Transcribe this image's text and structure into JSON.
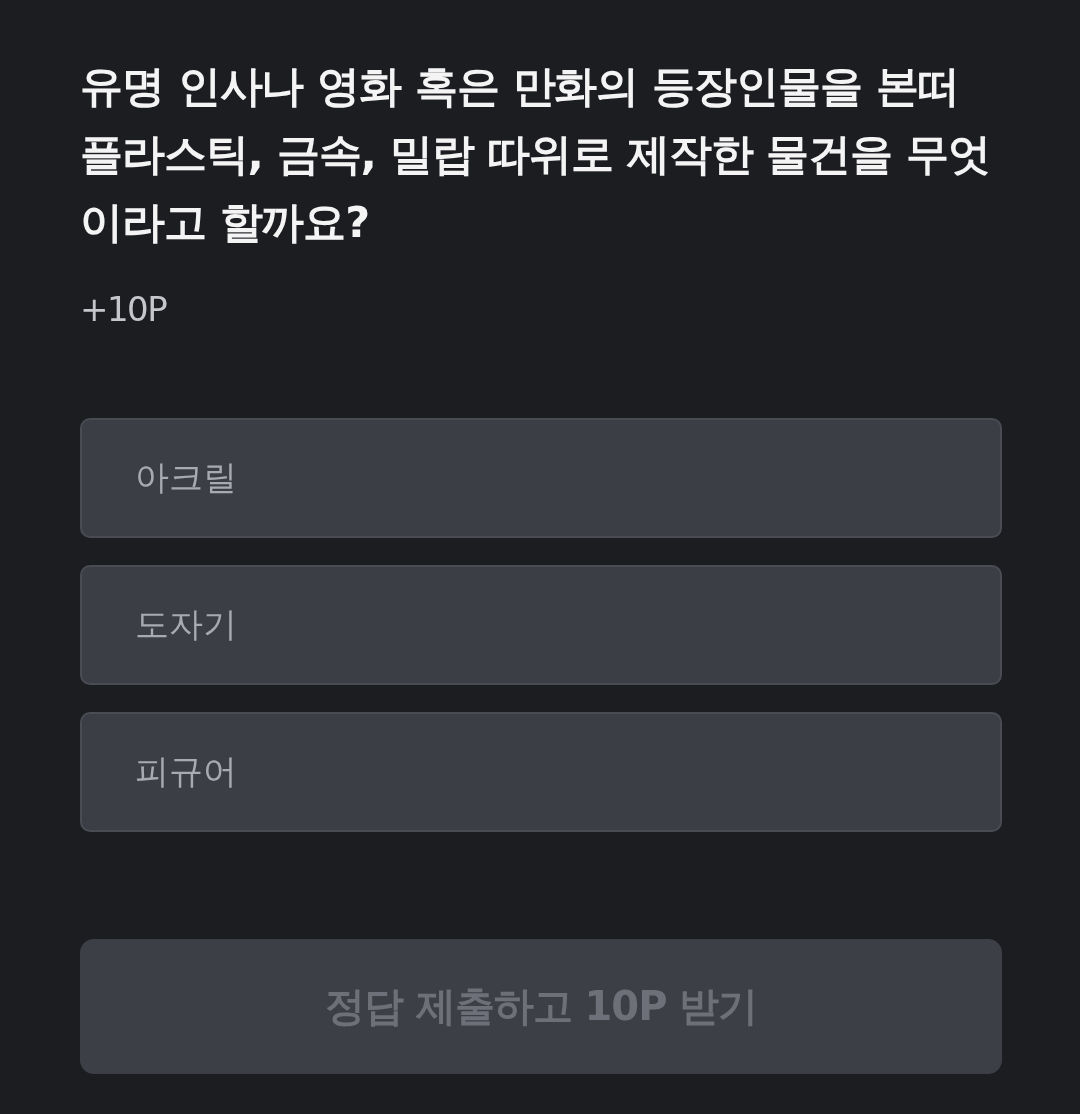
{
  "question": {
    "text": "유명 인사나 영화 혹은 만화의 등장인물을 본떠 플라스틱, 금속, 밀랍 따위로 제작한 물건을 무엇이라고 할까요?",
    "points": "+10P"
  },
  "options": [
    {
      "label": "아크릴",
      "selected": false
    },
    {
      "label": "도자기",
      "selected": false
    },
    {
      "label": "피규어",
      "selected": false
    }
  ],
  "submit_button": {
    "label": "정답 제출하고 10P 받기",
    "disabled": true
  }
}
